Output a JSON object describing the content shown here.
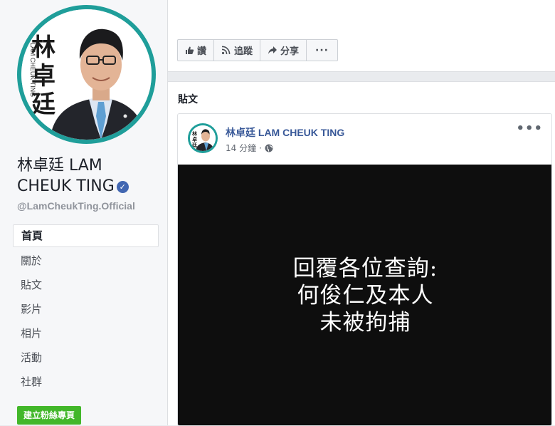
{
  "profile": {
    "name_line1": "林卓廷 LAM",
    "name_line2": "CHEUK TING",
    "handle": "@LamCheukTing.Official",
    "avatar_text": [
      "林",
      "卓",
      "廷"
    ],
    "avatar_subtext": "LAM CHEUK TING",
    "verified_icon": "verified-check-icon"
  },
  "nav": {
    "items": [
      {
        "label": "首頁",
        "active": true
      },
      {
        "label": "關於",
        "active": false
      },
      {
        "label": "貼文",
        "active": false
      },
      {
        "label": "影片",
        "active": false
      },
      {
        "label": "相片",
        "active": false
      },
      {
        "label": "活動",
        "active": false
      },
      {
        "label": "社群",
        "active": false
      }
    ],
    "create_page_label": "建立粉絲專頁"
  },
  "actions": {
    "like": "讚",
    "follow": "追蹤",
    "share": "分享",
    "more": "···"
  },
  "posts_section": {
    "title": "貼文"
  },
  "post": {
    "author": "林卓廷 LAM CHEUK TING",
    "time": "14 分鐘",
    "separator": "·",
    "privacy_icon": "globe-icon",
    "more": "•••",
    "media_lines": [
      "回覆各位查詢:",
      "何俊仁及本人",
      "未被拘捕"
    ]
  },
  "colors": {
    "accent": "#385898",
    "ring": "#1f9e9a",
    "green_button": "#42b72a",
    "media_bg": "#0e0e0e"
  }
}
